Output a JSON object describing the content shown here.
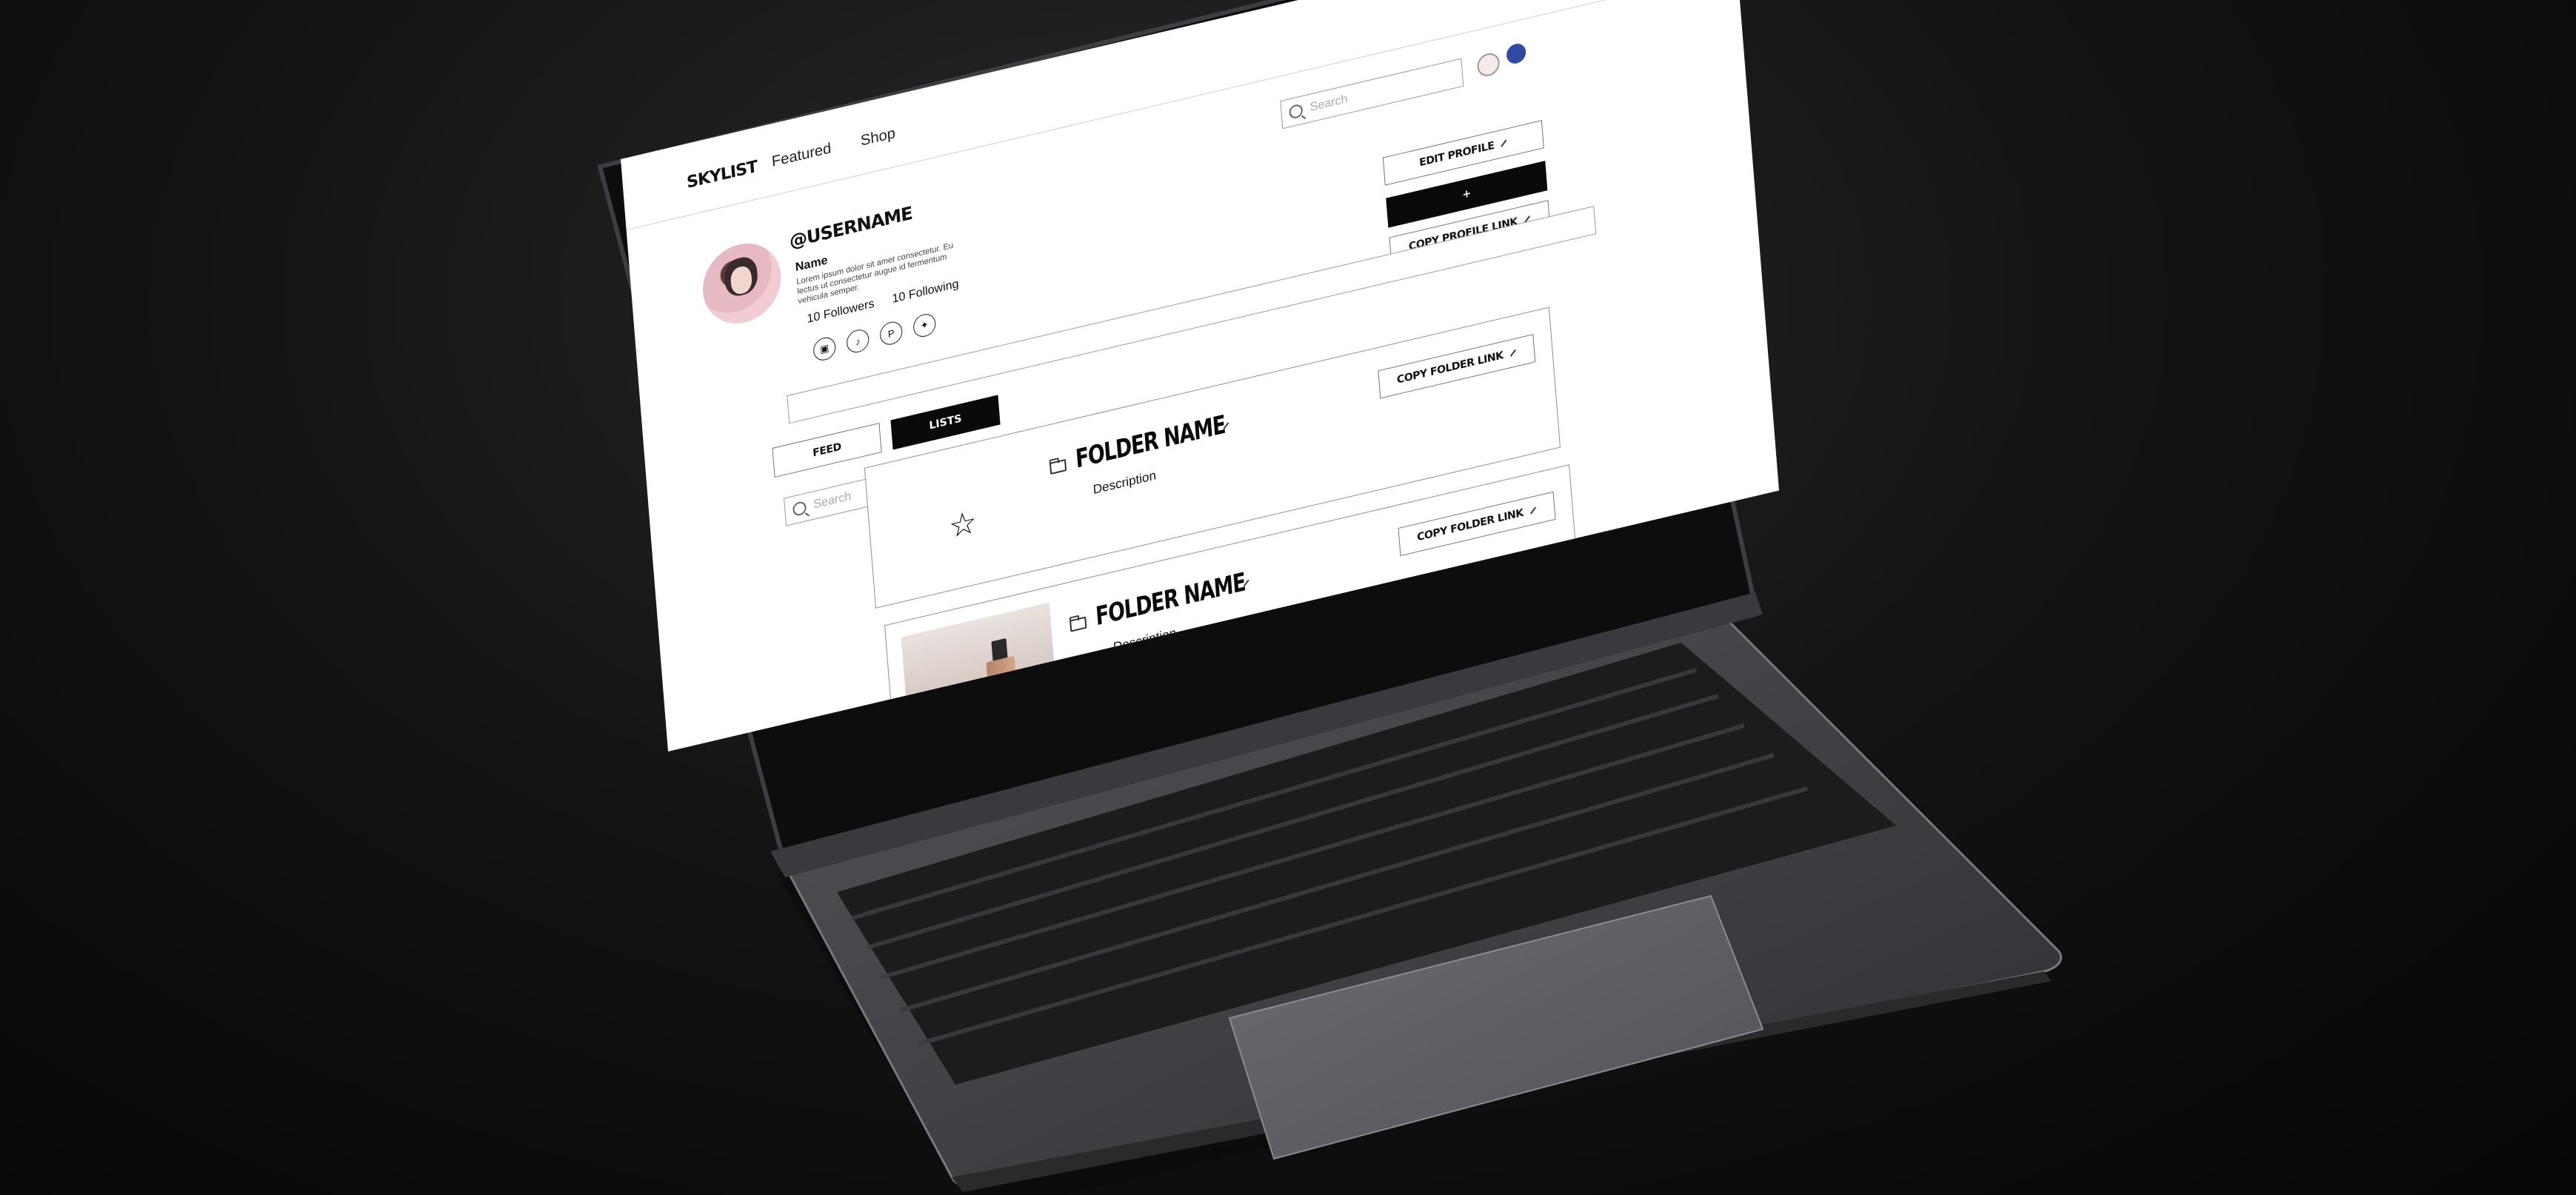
{
  "nav": {
    "brand": "SKYLIST",
    "links": [
      "Featured",
      "Shop"
    ],
    "search_placeholder": "Search"
  },
  "profile": {
    "handle": "@USERNAME",
    "name": "Name",
    "bio": "Lorem ipsum dolor sit amet consectetur. Eu lectus ut consectetur augue id fermentum vehicula semper.",
    "followers": "10 Followers",
    "following": "10 Following",
    "socials": [
      "instagram-icon",
      "tiktok-icon",
      "pinterest-icon",
      "twitter-icon"
    ],
    "edit_button": "EDIT PROFILE",
    "plus_button": "+",
    "copy_profile_button": "COPY PROFILE LINK"
  },
  "tabs": {
    "feed": "FEED",
    "lists": "LISTS"
  },
  "list_search": {
    "placeholder": "Search"
  },
  "folders": [
    {
      "title": "FOLDER NAME",
      "description": "Description",
      "copy_label": "COPY FOLDER LINK",
      "thumb": "star-icon"
    },
    {
      "title": "FOLDER NAME",
      "description": "Description",
      "copy_label": "COPY FOLDER LINK",
      "thumb": "product-photo"
    }
  ],
  "colors": {
    "accent": "#0a0a0a",
    "background": "#ffffff",
    "border": "#8f8f8f"
  }
}
